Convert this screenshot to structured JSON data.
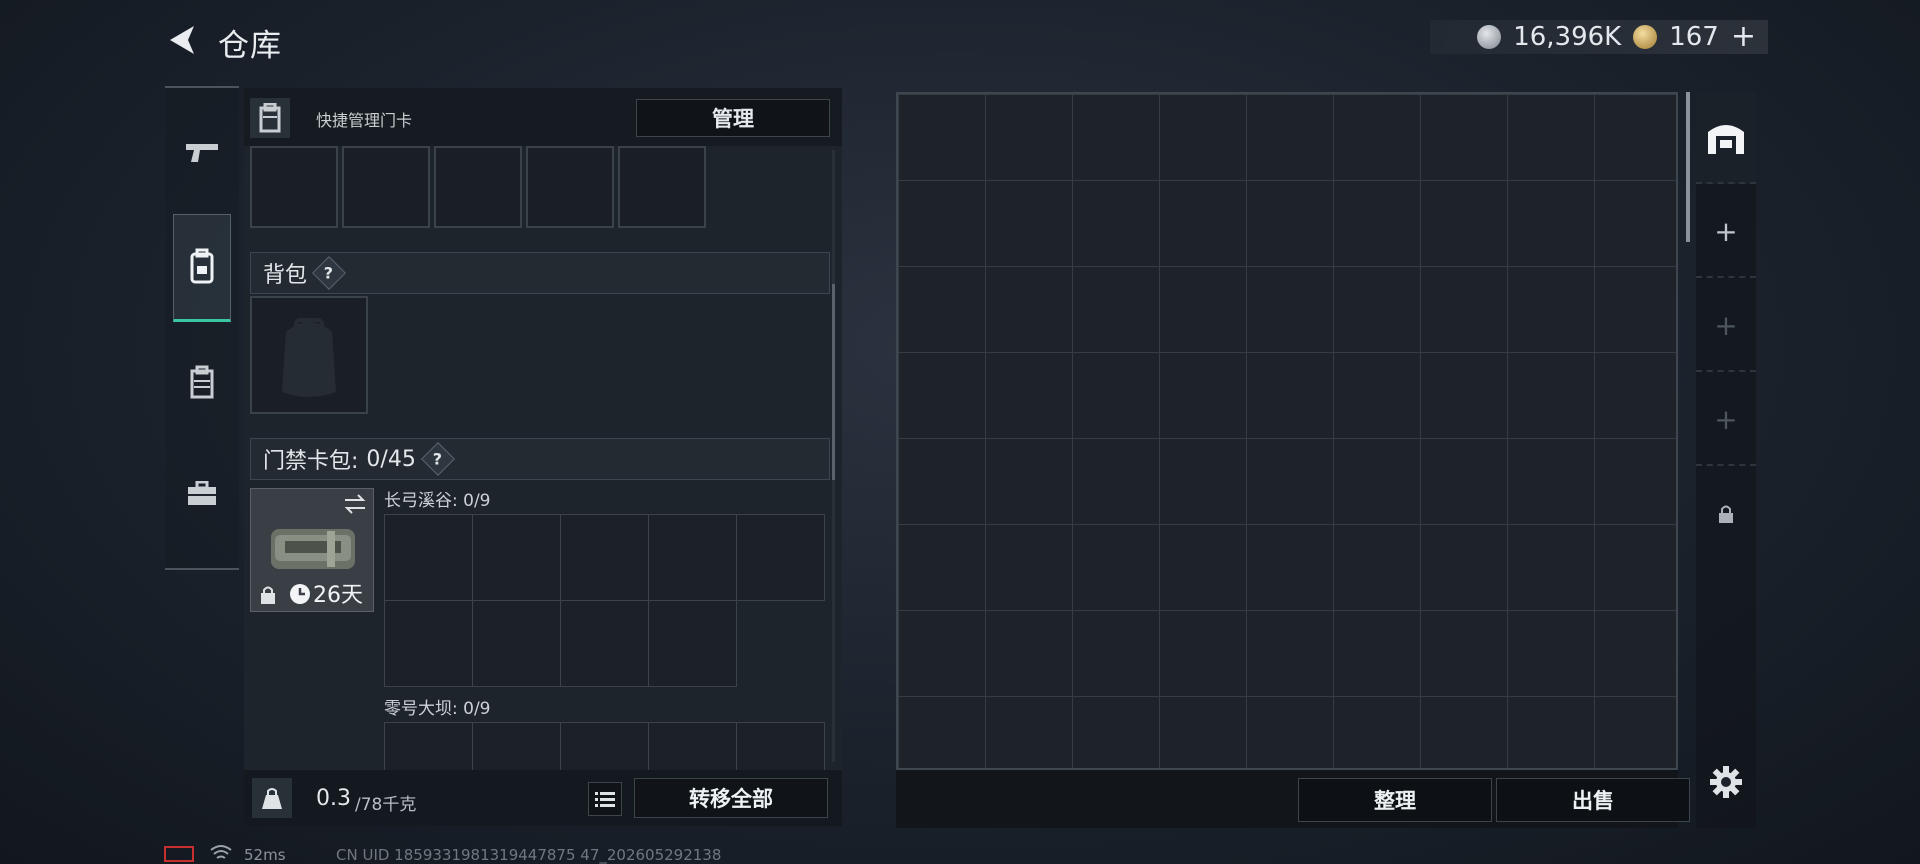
{
  "header": {
    "title": "仓库"
  },
  "currency": {
    "silver": "16,396K",
    "gold": "167",
    "add": "+"
  },
  "card_section": {
    "label": "快捷管理门卡",
    "manage_button": "管理"
  },
  "backpack": {
    "label": "背包",
    "help": "?"
  },
  "keycard_pack": {
    "label": "门禁卡包: ",
    "count": "0/45",
    "help": "?",
    "item": {
      "time_left": "26天",
      "locked": true
    },
    "maps": [
      {
        "name": "长弓溪谷: 0/9"
      },
      {
        "name": "零号大坝: 0/9"
      }
    ]
  },
  "footer": {
    "weight_current": "0.3",
    "weight_max": "/78千克",
    "transfer_all": "转移全部"
  },
  "storage": {
    "sort_button": "整理",
    "sell_button": "出售",
    "add_tab": "+"
  },
  "status": {
    "ping": "52ms",
    "uid": "CN UID 1859331981319447875 47_202605292138"
  },
  "colors": {
    "accent": "#38c7a0",
    "battery": "#c83030"
  }
}
